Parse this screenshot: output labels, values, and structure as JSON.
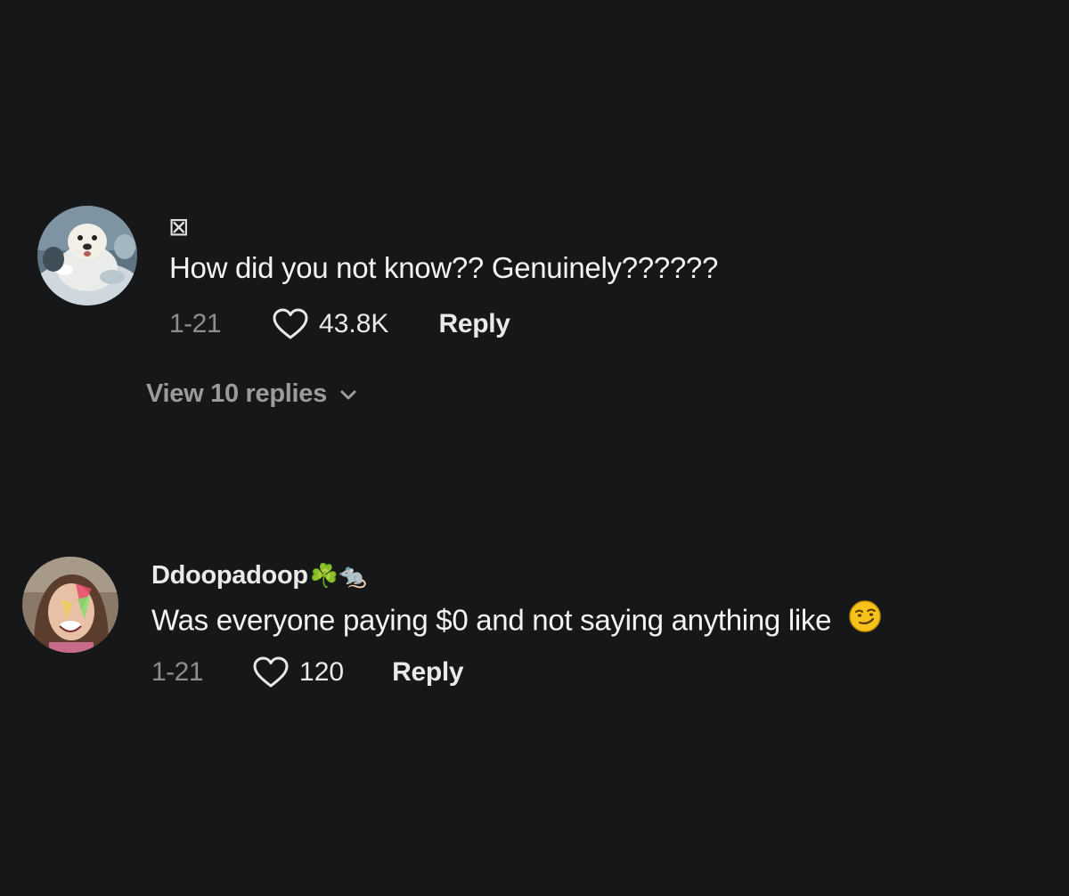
{
  "comments": [
    {
      "username": "",
      "username_glyph": "⊠",
      "text": "How did you not know?? Genuinely??????",
      "date": "1-21",
      "likes": "43.8K",
      "reply_label": "Reply",
      "view_replies_label": "View 10 replies",
      "avatar_icon": "otter-avatar"
    },
    {
      "username": "Ddoopadoop",
      "username_badges": "☘️🐀",
      "text": "Was everyone paying $0 and not saying anything like",
      "emoji": "smirking-face-emoji",
      "date": "1-21",
      "likes": "120",
      "reply_label": "Reply",
      "avatar_icon": "user-avatar"
    }
  ],
  "colors": {
    "background": "#161719",
    "text_primary": "#f3f3f3",
    "text_secondary": "#8d8d8f",
    "emoji_yellow": "#f7c21b"
  }
}
